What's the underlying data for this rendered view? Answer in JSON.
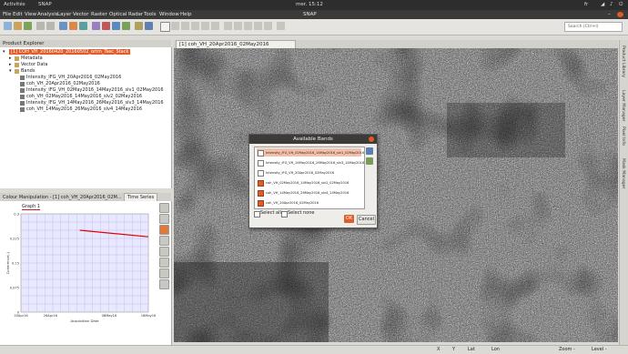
{
  "topbar": {
    "activities": "Activités",
    "app": "SNAP",
    "clock": "mer. 15:12",
    "lang": "fr"
  },
  "window_title": "SNAP",
  "menu": [
    "File",
    "Edit",
    "View",
    "Analysis",
    "Layer",
    "Vector",
    "Raster",
    "Optical",
    "Radar",
    "Tools",
    "Window",
    "Help"
  ],
  "search": {
    "placeholder": "Search (Ctrl+I)"
  },
  "product_explorer": {
    "title": "Product Explorer",
    "product": "[1] COH_VH_20160420_20160502_ortm_Tsec_Stack",
    "nodes": [
      "Metadata",
      "Vector Data",
      "Bands"
    ],
    "bands": [
      "Intensity_IFG_VH_20Apr2016_02May2016",
      "coh_VH_20Apr2016_02May2016",
      "Intensity_IFG_VH_02May2016_14May2016_slv1_02May2016",
      "coh_VH_02May2016_14May2016_slv2_02May2016",
      "Intensity_IFG_VH_14May2016_26May2016_slv3_14May2016",
      "coh_VH_14May2016_26May2016_slv4_14May2016"
    ]
  },
  "colour_panel": {
    "tab1": "Colour Manipulation - [1] coh_VH_20Apr2016_02M...",
    "tab2": "Time Series",
    "graph_label": "Graph 1"
  },
  "chart_data": {
    "type": "line",
    "title": "",
    "xlabel": "Acquisition Date",
    "ylabel": "Coherence(-)",
    "x_ticks": [
      "20Apr16",
      "26Apr16",
      "08May16",
      "16May16"
    ],
    "y_ticks": [
      "0.3",
      "0.225",
      "0.15",
      "0.075",
      "0"
    ],
    "ylim": [
      0,
      0.3
    ],
    "series": [
      {
        "color": "#e00000",
        "x": [
          "02May16",
          "16May16"
        ],
        "y": [
          0.25,
          0.23
        ]
      }
    ]
  },
  "image_view": {
    "tab": "[1] coh_VH_20Apr2016_02May2016"
  },
  "right_strip": [
    "Product Library",
    "Layer Manager",
    "Pixel Info",
    "Mask Manager"
  ],
  "dialog": {
    "title": "Available Bands",
    "items": [
      {
        "label": "Intensity_IFG_VH_02May2016_14May2016_slv1_02May2016",
        "checked": false,
        "highlight": true
      },
      {
        "label": "Intensity_IFG_VH_14May2016_26May2016_slv3_14May2016",
        "checked": false,
        "highlight": false
      },
      {
        "label": "Intensity_IFG_VH_20Apr2016_02May2016",
        "checked": false,
        "highlight": false
      },
      {
        "label": "coh_VH_02May2016_14May2016_slv2_02May2016",
        "checked": true,
        "highlight": false
      },
      {
        "label": "coh_VH_14May2016_26May2016_slv4_14May2016",
        "checked": true,
        "highlight": false
      },
      {
        "label": "coh_VH_20Apr2016_02May2016",
        "checked": true,
        "highlight": false
      }
    ],
    "select_all": "Select all",
    "select_none": "Select none",
    "ok": "OK",
    "cancel": "Cancel"
  },
  "status": {
    "x": "X",
    "y": "Y",
    "lat": "Lat",
    "lon": "Lon",
    "zoom": "Zoom -",
    "level": "Level -"
  }
}
